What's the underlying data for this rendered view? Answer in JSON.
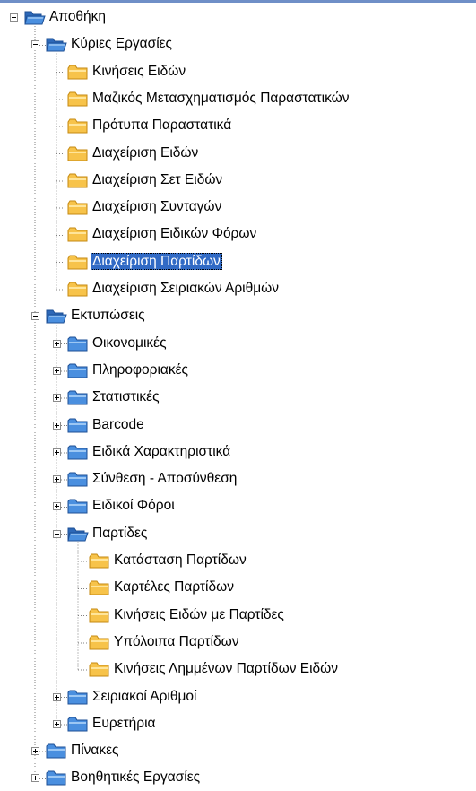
{
  "colors": {
    "selection_bg": "#316ac5",
    "selection_text": "#ffffff",
    "folder_blue": "#4a8fdf",
    "folder_yellow": "#f7c34a",
    "guide_line": "#808080"
  },
  "icons": {
    "root": "blue-folder-open-icon",
    "section_open": "blue-folder-open-icon",
    "section_closed": "blue-folder-icon",
    "leaf": "yellow-folder-icon"
  },
  "tree": {
    "root": {
      "label": "Αποθήκη",
      "expanded": true,
      "children": [
        {
          "label": "Κύριες Εργασίες",
          "expanded": true,
          "children": [
            {
              "label": "Κινήσεις Ειδών"
            },
            {
              "label": "Μαζικός Μετασχηματισμός Παραστατικών"
            },
            {
              "label": "Πρότυπα Παραστατικά"
            },
            {
              "label": "Διαχείριση Ειδών"
            },
            {
              "label": "Διαχείριση Σετ Ειδών"
            },
            {
              "label": "Διαχείριση Συνταγών"
            },
            {
              "label": "Διαχείριση Ειδικών Φόρων"
            },
            {
              "label": "Διαχείριση Παρτίδων",
              "selected": true
            },
            {
              "label": "Διαχείριση Σειριακών Αριθμών"
            }
          ]
        },
        {
          "label": "Εκτυπώσεις",
          "expanded": true,
          "children": [
            {
              "label": "Οικονομικές",
              "expanded": false
            },
            {
              "label": "Πληροφοριακές",
              "expanded": false
            },
            {
              "label": "Στατιστικές",
              "expanded": false
            },
            {
              "label": "Barcode",
              "expanded": false
            },
            {
              "label": "Ειδικά Χαρακτηριστικά",
              "expanded": false
            },
            {
              "label": "Σύνθεση - Αποσύνθεση",
              "expanded": false
            },
            {
              "label": "Ειδικοί Φόροι",
              "expanded": false
            },
            {
              "label": "Παρτίδες",
              "expanded": true,
              "children": [
                {
                  "label": "Κατάσταση Παρτίδων"
                },
                {
                  "label": "Καρτέλες Παρτίδων"
                },
                {
                  "label": "Κινήσεις Ειδών με Παρτίδες"
                },
                {
                  "label": "Υπόλοιπα Παρτίδων"
                },
                {
                  "label": "Κινήσεις Λημμένων Παρτίδων Ειδών"
                }
              ]
            },
            {
              "label": "Σειριακοί Αριθμοί",
              "expanded": false
            },
            {
              "label": "Ευρετήρια",
              "expanded": false
            }
          ]
        },
        {
          "label": "Πίνακες",
          "expanded": false
        },
        {
          "label": "Βοηθητικές Εργασίες",
          "expanded": false
        }
      ]
    }
  }
}
